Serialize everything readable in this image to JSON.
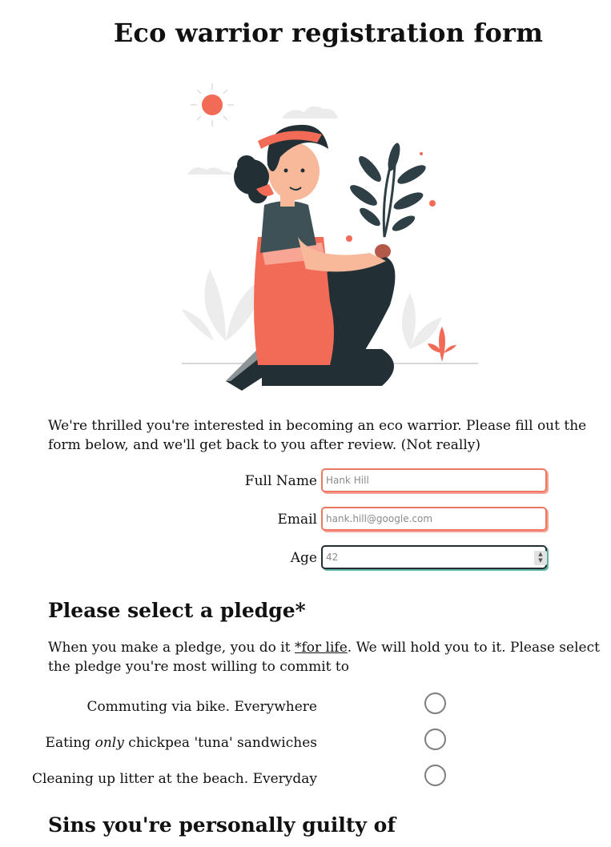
{
  "title": "Eco warrior registration form",
  "intro": "We're thrilled you're interested in becoming an eco warrior. Please fill out the form below, and we'll get back to you after review. (Not really)",
  "fields": {
    "full_name": {
      "label": "Full Name",
      "placeholder": "Hank Hill"
    },
    "email": {
      "label": "Email",
      "placeholder": "hank.hill@google.com"
    },
    "age": {
      "label": "Age",
      "placeholder": "42"
    }
  },
  "pledge": {
    "heading": "Please select a pledge*",
    "desc_before": "When you make a pledge, you do it ",
    "desc_link": "*for life",
    "desc_after": ". We will hold you to it. Please select the pledge you're most willing to commit to",
    "options": [
      {
        "label": "Commuting via bike. Everywhere"
      },
      {
        "label_pre": "Eating ",
        "label_em": "only",
        "label_post": " chickpea 'tuna' sandwiches"
      },
      {
        "label": "Cleaning up litter at the beach. Everyday"
      }
    ]
  },
  "sins": {
    "heading": "Sins you're personally guilty of"
  },
  "colors": {
    "accent": "#ef7762",
    "dark": "#223036",
    "teal": "#5fb5a4"
  }
}
